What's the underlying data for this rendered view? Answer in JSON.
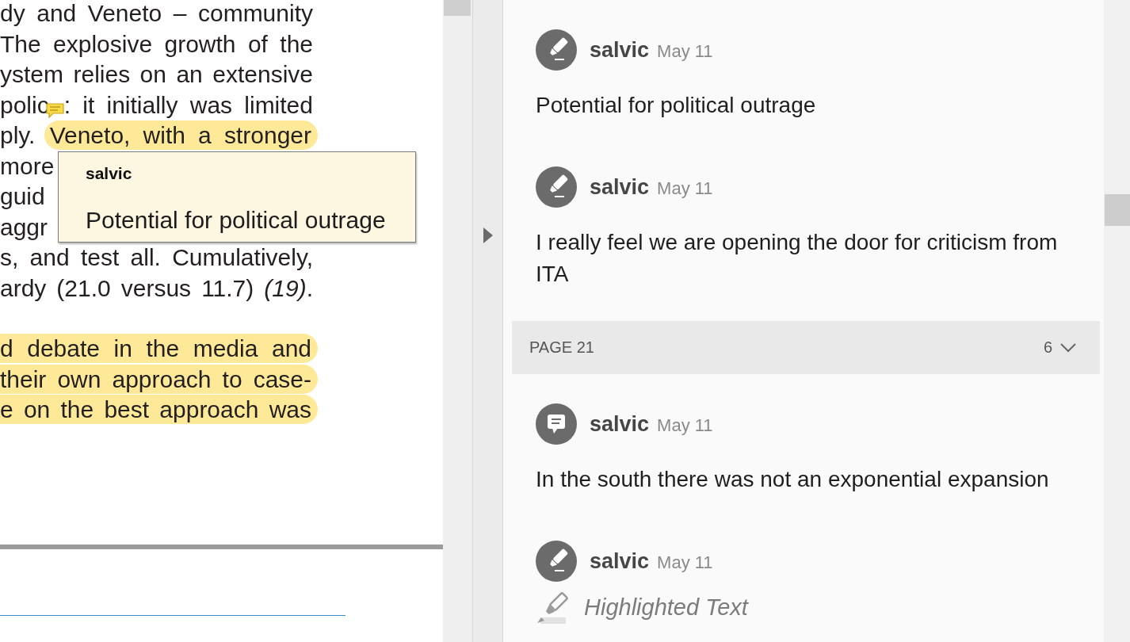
{
  "document": {
    "paragraphs": [
      {
        "lines": [
          {
            "segments": [
              {
                "text": "dy and Veneto – community",
                "highlighted": false,
                "note_marker": false
              }
            ]
          },
          {
            "segments": [
              {
                "text": "The explosive growth of the",
                "highlighted": false,
                "note_marker": false
              }
            ]
          },
          {
            "segments": [
              {
                "text": "ystem relies on an extensive",
                "highlighted": false,
                "note_marker": false
              }
            ]
          },
          {
            "segments": [
              {
                "text": "polic",
                "highlighted": false,
                "note_marker": true
              },
              {
                "text": ": it initially was limited",
                "highlighted": false,
                "note_marker": false
              }
            ]
          },
          {
            "segments": [
              {
                "text": "ply.",
                "highlighted": false,
                "note_marker": false
              },
              {
                "text": "Veneto, with a stronger",
                "highlighted": true,
                "note_marker": false
              }
            ]
          },
          {
            "segments": [
              {
                "text": "more",
                "highlighted": false,
                "note_marker": false
              }
            ]
          },
          {
            "segments": [
              {
                "text": "guid",
                "highlighted": false,
                "note_marker": false
              }
            ]
          },
          {
            "segments": [
              {
                "text": "aggr",
                "highlighted": false,
                "note_marker": false
              }
            ]
          },
          {
            "segments": [
              {
                "text": "s, and test all. Cumulatively,",
                "highlighted": false,
                "note_marker": false
              }
            ]
          },
          {
            "segments": [
              {
                "text": "ardy (21.0 versus 11.7) *(19)*.",
                "highlighted": false,
                "note_marker": false
              }
            ]
          }
        ]
      },
      {
        "lines": [
          {
            "segments": [
              {
                "text": "d debate in the media and",
                "highlighted": true,
                "note_marker": false
              }
            ]
          },
          {
            "segments": [
              {
                "text": "their own approach to case-",
                "highlighted": true,
                "note_marker": false
              }
            ]
          },
          {
            "segments": [
              {
                "text": "e on the best approach was",
                "highlighted": true,
                "note_marker": false
              }
            ]
          }
        ]
      }
    ]
  },
  "tooltip": {
    "author": "salvic",
    "text": "Potential for political outrage"
  },
  "comments_panel": {
    "items": [
      {
        "kind": "highlight",
        "author": "salvic",
        "date": "May 11",
        "text": "Potential for political outrage"
      },
      {
        "kind": "highlight",
        "author": "salvic",
        "date": "May 11",
        "text": "I really feel we are opening the door for criticism from ITA"
      },
      {
        "kind": "page_header",
        "label": "PAGE 21",
        "count": "6"
      },
      {
        "kind": "note",
        "author": "salvic",
        "date": "May 11",
        "text": "In the south there was not an exponential expansion"
      },
      {
        "kind": "highlight",
        "author": "salvic",
        "date": "May 11",
        "excerpt": "Highlighted Text"
      }
    ]
  }
}
